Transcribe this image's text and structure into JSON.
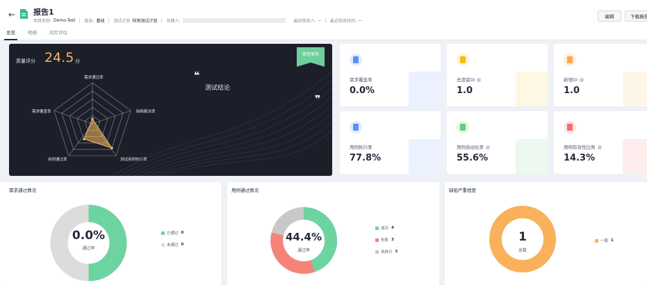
{
  "header": {
    "back_icon": "arrow-left-icon",
    "title": "报告1",
    "meta": [
      {
        "label": "项目名称:",
        "value": "Demo-Test"
      },
      {
        "label": "版本:",
        "value": "基线"
      },
      {
        "label": "测试计划",
        "value": "样例测试计划"
      },
      {
        "label": "创建人:",
        "value": ""
      },
      {
        "label": "最后修改人:",
        "value": "--"
      },
      {
        "label": "最近修改时间:",
        "value": "--"
      }
    ],
    "edit_label": "编辑",
    "download_label": "下载报告"
  },
  "tabs": [
    {
      "label": "总览",
      "active": true
    },
    {
      "label": "明细",
      "active": false
    },
    {
      "label": "风险评估",
      "active": false
    }
  ],
  "quality": {
    "label": "质量评分",
    "score": "24.5",
    "unit": "分",
    "badge": "商用发布",
    "conclusion": "测试结论",
    "quote_open": "❝",
    "quote_close": "❞",
    "radar_axes": [
      "需求通过率",
      "缺陷解决率",
      "测试用例执行率",
      "用例通过率",
      "需求覆盖率"
    ],
    "accent": "#f4b95d"
  },
  "metrics": [
    {
      "label": "需求覆盖率",
      "value": "0.0%",
      "info": false,
      "icon": "coverage-doc-icon",
      "color": "#5b8ff9"
    },
    {
      "label": "总遗留DI",
      "value": "1.0",
      "info": true,
      "icon": "di-doc-icon",
      "color": "#f6bd16"
    },
    {
      "label": "新增DI",
      "value": "1.0",
      "info": true,
      "icon": "new-di-doc-icon",
      "color": "#f7a94b"
    },
    {
      "label": "用例执行率",
      "value": "77.8%",
      "info": false,
      "icon": "execution-doc-icon",
      "color": "#5b8ff9"
    },
    {
      "label": "用例自动化率",
      "value": "55.6%",
      "info": true,
      "icon": "automation-doc-icon",
      "color": "#6dc87e"
    },
    {
      "label": "用例有效性比例",
      "value": "14.3%",
      "info": true,
      "icon": "validity-doc-icon",
      "color": "#f36e6e"
    }
  ],
  "requirement_pass": {
    "title": "需求通过情况",
    "center_value": "0.0%",
    "center_label": "通过率",
    "legend": [
      {
        "label": "已通过",
        "count": 0,
        "color": "#6dd3a0"
      },
      {
        "label": "未通过",
        "count": 0,
        "color": "#dcdcdc"
      }
    ]
  },
  "case_pass": {
    "title": "用例通过情况",
    "center_value": "44.4%",
    "center_label": "通过率",
    "legend": [
      {
        "label": "成功",
        "count": 4,
        "color": "#6dd3a0"
      },
      {
        "label": "失败",
        "count": 3,
        "color": "#f4837a"
      },
      {
        "label": "未执行",
        "count": 2,
        "color": "#c8c8c8"
      }
    ]
  },
  "defect_severity": {
    "title": "缺陷严重程度",
    "center_value": "1",
    "center_label": "总数",
    "legend": [
      {
        "label": "一般",
        "count": 1,
        "color": "#f9b15b"
      }
    ]
  }
}
